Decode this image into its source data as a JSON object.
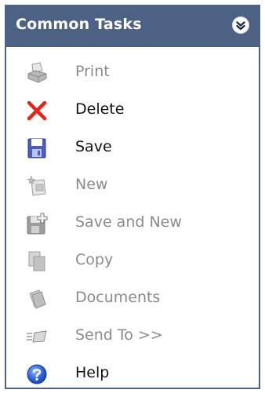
{
  "panel": {
    "title": "Common Tasks",
    "header_color": "#4d6185",
    "collapse_icon": "double-chevron-up-icon"
  },
  "tasks": [
    {
      "label": "Print",
      "icon": "printer-icon",
      "enabled": false
    },
    {
      "label": "Delete",
      "icon": "red-x-icon",
      "enabled": true
    },
    {
      "label": "Save",
      "icon": "floppy-disk-icon",
      "enabled": true
    },
    {
      "label": "New",
      "icon": "new-document-icon",
      "enabled": false
    },
    {
      "label": "Save and New",
      "icon": "save-and-new-icon",
      "enabled": false
    },
    {
      "label": "Copy",
      "icon": "copy-icon",
      "enabled": false
    },
    {
      "label": "Documents",
      "icon": "documents-icon",
      "enabled": false
    },
    {
      "label": "Send To >>",
      "icon": "send-to-icon",
      "enabled": false
    },
    {
      "label": "Help",
      "icon": "help-icon",
      "enabled": true
    }
  ]
}
